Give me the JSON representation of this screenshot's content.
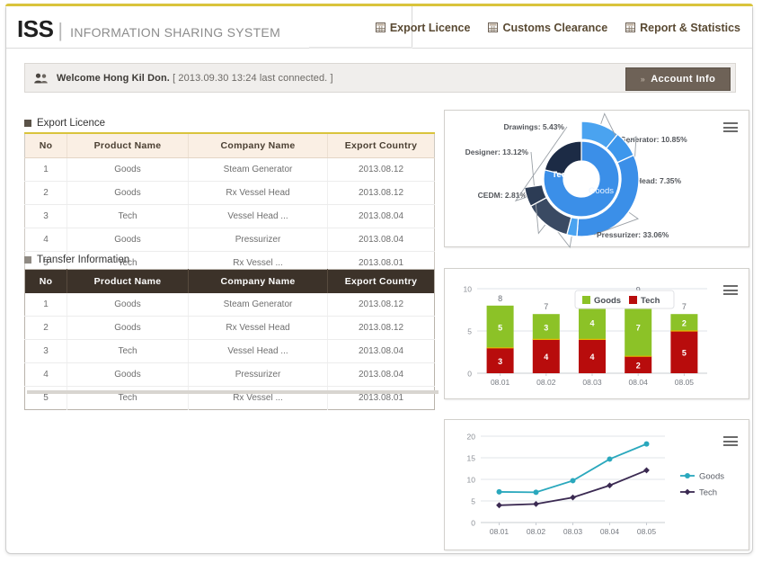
{
  "brand": {
    "logo": "ISS",
    "logo_divider": "|",
    "subtitle": "INFORMATION SHARING SYSTEM"
  },
  "nav": {
    "items": [
      {
        "label": "Export Licence",
        "icon": "grid-icon"
      },
      {
        "label": "Customs Clearance",
        "icon": "grid-icon"
      },
      {
        "label": "Report & Statistics",
        "icon": "grid-icon"
      }
    ]
  },
  "welcome": {
    "icon": "users-icon",
    "greeting": "Welcome Hong Kil Don.",
    "meta": "[ 2013.09.30 13:24 last connected. ]",
    "account_button": "Account Info",
    "account_chevron": "»"
  },
  "sections": {
    "export_licence": {
      "title": "Export Licence",
      "columns": [
        "No",
        "Product Name",
        "Company Name",
        "Export Country"
      ],
      "rows": [
        [
          "1",
          "Goods",
          "Steam Generator",
          "2013.08.12"
        ],
        [
          "2",
          "Goods",
          "Rx Vessel Head",
          "2013.08.12"
        ],
        [
          "3",
          "Tech",
          "Vessel Head ...",
          "2013.08.04"
        ],
        [
          "4",
          "Goods",
          "Pressurizer",
          "2013.08.04"
        ],
        [
          "5",
          "Tech",
          "Rx Vessel ...",
          "2013.08.01"
        ]
      ]
    },
    "transfer_information": {
      "title": "Transfer Information",
      "columns": [
        "No",
        "Product Name",
        "Company Name",
        "Export Country"
      ],
      "rows": [
        [
          "1",
          "Goods",
          "Steam Generator",
          "2013.08.12"
        ],
        [
          "2",
          "Goods",
          "Rx Vessel Head",
          "2013.08.12"
        ],
        [
          "3",
          "Tech",
          "Vessel Head ...",
          "2013.08.04"
        ],
        [
          "4",
          "Goods",
          "Pressurizer",
          "2013.08.04"
        ],
        [
          "5",
          "Tech",
          "Rx Vessel ...",
          "2013.08.01"
        ]
      ]
    }
  },
  "chart_data": [
    {
      "id": "donut",
      "type": "pie",
      "title": "",
      "legend_position": "none",
      "inner_ring": [
        {
          "name": "Goods",
          "value": 78.88,
          "color": "#3b8fe8"
        },
        {
          "name": "Tech",
          "value": 21.12,
          "color": "#1c2b45"
        }
      ],
      "outer_ring": [
        {
          "name": "Generator",
          "value": 10.85,
          "label": "Generator: 10.85%",
          "color": "#4aa3f0"
        },
        {
          "name": "Head",
          "value": 7.35,
          "label": "Head: 7.35%",
          "color": "#3d97ec"
        },
        {
          "name": "Pressurizer",
          "value": 33.06,
          "label": "Pressurizer: 33.06%",
          "color": "#3b8fe8"
        },
        {
          "name": "CEDM",
          "value": 2.81,
          "label": "CEDM: 2.81%",
          "color": "#4aa3f0"
        },
        {
          "name": "Designer",
          "value": 13.12,
          "label": "Designer: 13.12%",
          "color": "#3a4a63"
        },
        {
          "name": "Drawings",
          "value": 5.43,
          "label": "Drawings: 5.43%",
          "color": "#2c3c55"
        }
      ],
      "center_labels": [
        "Tech",
        "Goods"
      ]
    },
    {
      "id": "bar",
      "type": "bar",
      "stacked": true,
      "categories": [
        "08.01",
        "08.02",
        "08.03",
        "08.04",
        "08.05"
      ],
      "series": [
        {
          "name": "Tech",
          "values": [
            3,
            4,
            4,
            2,
            5
          ],
          "color": "#b80c0c"
        },
        {
          "name": "Goods",
          "values": [
            5,
            3,
            4,
            7,
            2
          ],
          "color": "#8cc227"
        }
      ],
      "totals": [
        8,
        7,
        8,
        9,
        7
      ],
      "ylim": [
        0,
        10
      ],
      "yticks": [
        0,
        5,
        10
      ],
      "xlabel": "",
      "ylabel": "",
      "legend_position": "top-center",
      "grid": true
    },
    {
      "id": "line",
      "type": "line",
      "categories": [
        "08.01",
        "08.02",
        "08.03",
        "08.04",
        "08.05"
      ],
      "series": [
        {
          "name": "Goods",
          "values": [
            7.1,
            7.0,
            9.7,
            14.7,
            18.2
          ],
          "color": "#2aa8bd"
        },
        {
          "name": "Tech",
          "values": [
            4.0,
            4.3,
            5.8,
            8.6,
            12.1
          ],
          "color": "#3b2a52"
        }
      ],
      "ylim": [
        0,
        20
      ],
      "yticks": [
        0,
        5,
        10,
        15,
        20
      ],
      "xlabel": "",
      "ylabel": "",
      "legend_position": "right",
      "grid": true
    }
  ],
  "icons": {
    "menu": "hamburger-icon"
  }
}
